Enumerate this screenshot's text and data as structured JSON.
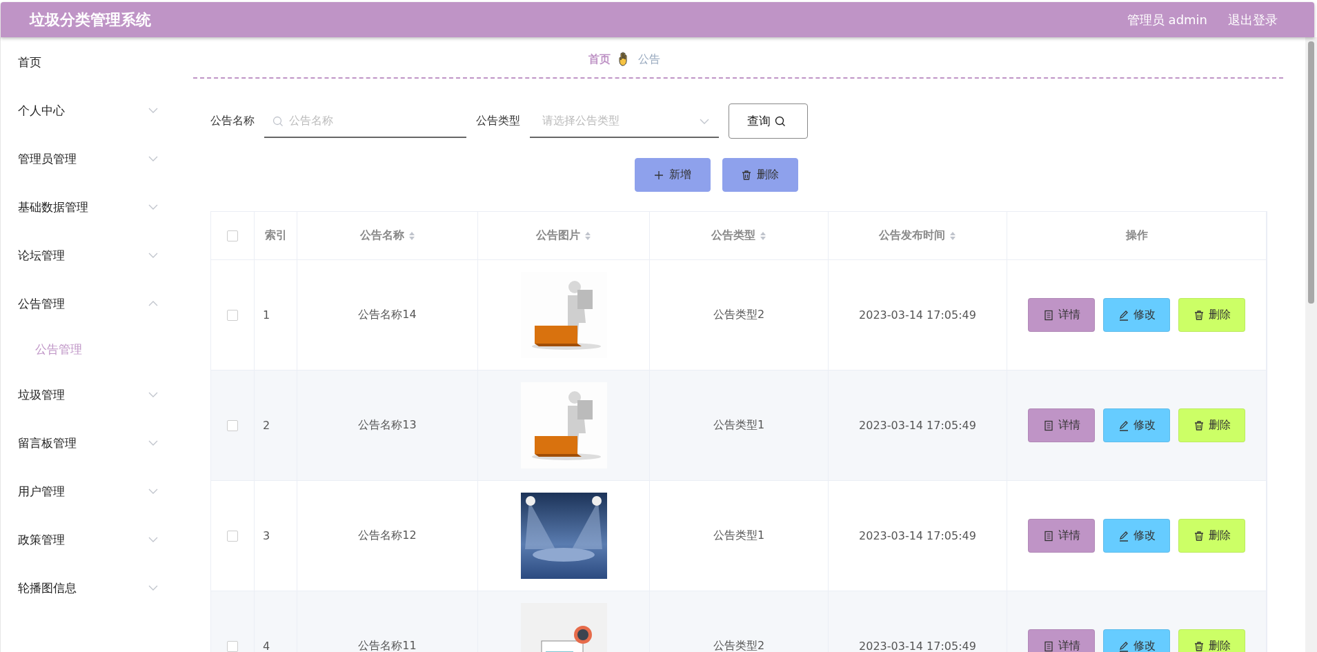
{
  "header": {
    "title": "垃圾分类管理系统",
    "user_label": "管理员 admin",
    "logout": "退出登录"
  },
  "sidebar": {
    "items": [
      {
        "label": "首页",
        "kind": "link"
      },
      {
        "label": "个人中心",
        "kind": "group",
        "expanded": false
      },
      {
        "label": "管理员管理",
        "kind": "group",
        "expanded": false
      },
      {
        "label": "基础数据管理",
        "kind": "group",
        "expanded": false
      },
      {
        "label": "论坛管理",
        "kind": "group",
        "expanded": false
      },
      {
        "label": "公告管理",
        "kind": "group",
        "expanded": true,
        "children": [
          {
            "label": "公告管理",
            "selected": true
          }
        ]
      },
      {
        "label": "垃圾管理",
        "kind": "group",
        "expanded": false
      },
      {
        "label": "留言板管理",
        "kind": "group",
        "expanded": false
      },
      {
        "label": "用户管理",
        "kind": "group",
        "expanded": false
      },
      {
        "label": "政策管理",
        "kind": "group",
        "expanded": false
      },
      {
        "label": "轮播图信息",
        "kind": "group",
        "expanded": false
      }
    ]
  },
  "breadcrumb": [
    {
      "label": "首页",
      "current": false
    },
    {
      "label": "公告",
      "current": true
    }
  ],
  "search": {
    "fields": [
      {
        "label": "公告名称",
        "placeholder": "公告名称",
        "kind": "input"
      },
      {
        "label": "公告类型",
        "placeholder": "请选择公告类型",
        "kind": "select"
      }
    ],
    "button": "查询"
  },
  "actions": [
    {
      "label": "新增",
      "kind": "add"
    },
    {
      "label": "删除",
      "kind": "delete"
    }
  ],
  "table": {
    "select_all": {
      "checked": false
    },
    "columns": [
      {
        "label": "索引",
        "sortable": false
      },
      {
        "label": "公告名称",
        "sortable": true
      },
      {
        "label": "公告图片",
        "sortable": true
      },
      {
        "label": "公告类型",
        "sortable": true
      },
      {
        "label": "公告发布时间",
        "sortable": true
      },
      {
        "label": "操作",
        "sortable": false
      }
    ],
    "rows": [
      {
        "checked": false,
        "index": "1",
        "name": "公告名称14",
        "image": {
          "kind": "news-figure"
        },
        "type": "公告类型2",
        "time": "2023-03-14 17:05:49",
        "actions": [
          {
            "label": "详情",
            "kind": "detail"
          },
          {
            "label": "修改",
            "kind": "edit"
          },
          {
            "label": "删除",
            "kind": "delete"
          }
        ]
      },
      {
        "checked": false,
        "index": "2",
        "name": "公告名称13",
        "image": {
          "kind": "news-figure"
        },
        "type": "公告类型1",
        "time": "2023-03-14 17:05:49",
        "actions": [
          {
            "label": "详情",
            "kind": "detail"
          },
          {
            "label": "修改",
            "kind": "edit"
          },
          {
            "label": "删除",
            "kind": "delete"
          }
        ]
      },
      {
        "checked": false,
        "index": "3",
        "name": "公告名称12",
        "image": {
          "kind": "spotlight"
        },
        "type": "公告类型1",
        "time": "2023-03-14 17:05:49",
        "actions": [
          {
            "label": "详情",
            "kind": "detail"
          },
          {
            "label": "修改",
            "kind": "edit"
          },
          {
            "label": "删除",
            "kind": "delete"
          }
        ]
      },
      {
        "checked": false,
        "index": "4",
        "name": "公告名称11",
        "image": {
          "kind": "newspaper"
        },
        "type": "公告类型2",
        "time": "2023-03-14 17:05:49",
        "actions": [
          {
            "label": "详情",
            "kind": "detail"
          },
          {
            "label": "修改",
            "kind": "edit"
          },
          {
            "label": "删除",
            "kind": "delete"
          }
        ]
      }
    ]
  }
}
